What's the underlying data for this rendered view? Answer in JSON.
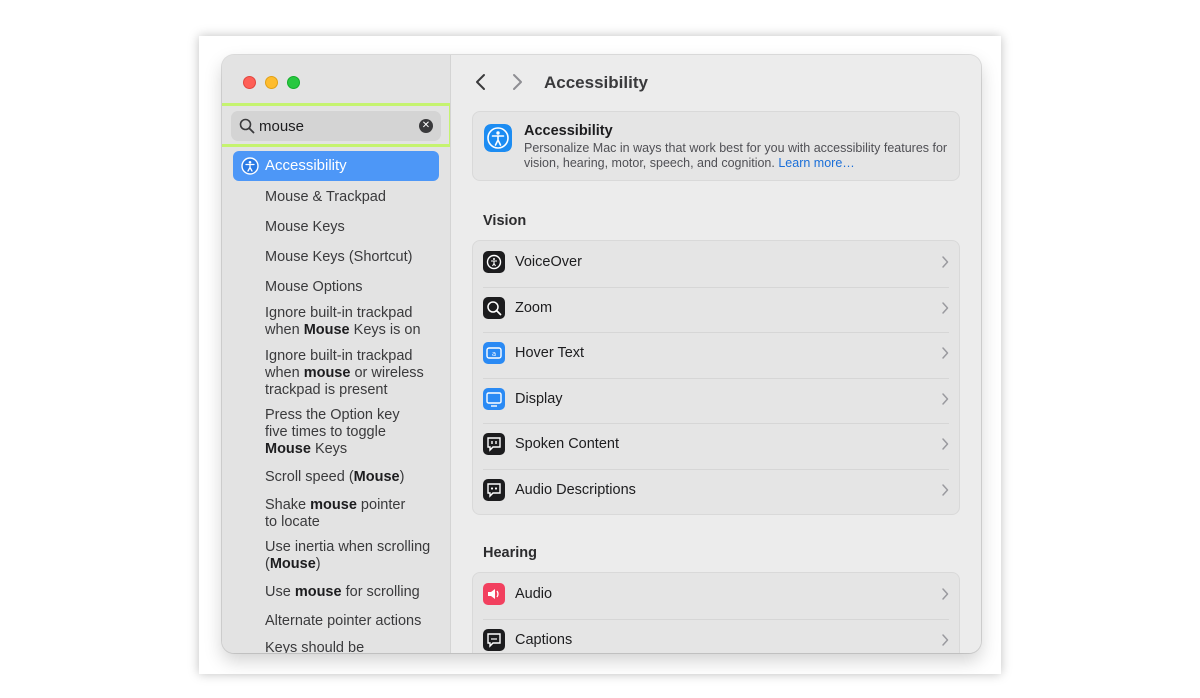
{
  "sidebar": {
    "search": {
      "value": "mouse",
      "placeholder": "Search"
    },
    "selected": {
      "label": "Accessibility",
      "icon": "accessibility-icon"
    },
    "results": [
      {
        "parts": [
          {
            "t": "Mouse & Trackpad",
            "b": false
          }
        ]
      },
      {
        "parts": [
          {
            "t": "Mouse Keys",
            "b": false
          }
        ]
      },
      {
        "parts": [
          {
            "t": "Mouse Keys (Shortcut)",
            "b": false
          }
        ]
      },
      {
        "parts": [
          {
            "t": "Mouse Options",
            "b": false
          }
        ]
      },
      {
        "parts": [
          {
            "t": "Ignore built-in trackpad when ",
            "b": false
          },
          {
            "t": "Mouse",
            "b": true
          },
          {
            "t": " Keys is on",
            "b": false
          }
        ]
      },
      {
        "parts": [
          {
            "t": "Ignore built-in trackpad when ",
            "b": false
          },
          {
            "t": "mouse",
            "b": true
          },
          {
            "t": " or wireless trackpad is present",
            "b": false
          }
        ]
      },
      {
        "parts": [
          {
            "t": "Press the Option key five times to toggle ",
            "b": false
          },
          {
            "t": "Mouse",
            "b": true
          },
          {
            "t": " Keys",
            "b": false
          }
        ]
      },
      {
        "parts": [
          {
            "t": "Scroll speed (",
            "b": false
          },
          {
            "t": "Mouse",
            "b": true
          },
          {
            "t": ")",
            "b": false
          }
        ]
      },
      {
        "parts": [
          {
            "t": "Shake ",
            "b": false
          },
          {
            "t": "mouse",
            "b": true
          },
          {
            "t": " pointer to locate",
            "b": false
          }
        ]
      },
      {
        "parts": [
          {
            "t": "Use inertia when scrolling (",
            "b": false
          },
          {
            "t": "Mouse",
            "b": true
          },
          {
            "t": ")",
            "b": false
          }
        ]
      },
      {
        "parts": [
          {
            "t": "Use ",
            "b": false
          },
          {
            "t": "mouse",
            "b": true
          },
          {
            "t": " for scrolling",
            "b": false
          }
        ]
      },
      {
        "parts": [
          {
            "t": "Alternate pointer actions",
            "b": false
          }
        ]
      },
      {
        "parts": [
          {
            "t": "Keys should be",
            "b": false
          }
        ]
      }
    ]
  },
  "main": {
    "title": "Accessibility",
    "header": {
      "title": "Accessibility",
      "description": "Personalize Mac in ways that work best for you with accessibility features for vision, hearing, motor, speech, and cognition.",
      "learn_more": "Learn more…"
    },
    "sections": [
      {
        "title": "Vision",
        "items": [
          {
            "label": "VoiceOver",
            "icon": "voiceover-icon",
            "color": "#1c1c1e"
          },
          {
            "label": "Zoom",
            "icon": "zoom-icon",
            "color": "#1c1c1e"
          },
          {
            "label": "Hover Text",
            "icon": "hover-text-icon",
            "color": "#2a8af4"
          },
          {
            "label": "Display",
            "icon": "display-icon",
            "color": "#2a8af4"
          },
          {
            "label": "Spoken Content",
            "icon": "spoken-content-icon",
            "color": "#1c1c1e"
          },
          {
            "label": "Audio Descriptions",
            "icon": "audio-descriptions-icon",
            "color": "#1c1c1e"
          }
        ]
      },
      {
        "title": "Hearing",
        "items": [
          {
            "label": "Audio",
            "icon": "audio-icon",
            "color": "#f2405f"
          },
          {
            "label": "Captions",
            "icon": "captions-icon",
            "color": "#1c1c1e"
          }
        ]
      }
    ]
  },
  "colors": {
    "accent": "#4d97f7",
    "search_highlight": "#c5f36f",
    "link": "#1b6fd8"
  }
}
